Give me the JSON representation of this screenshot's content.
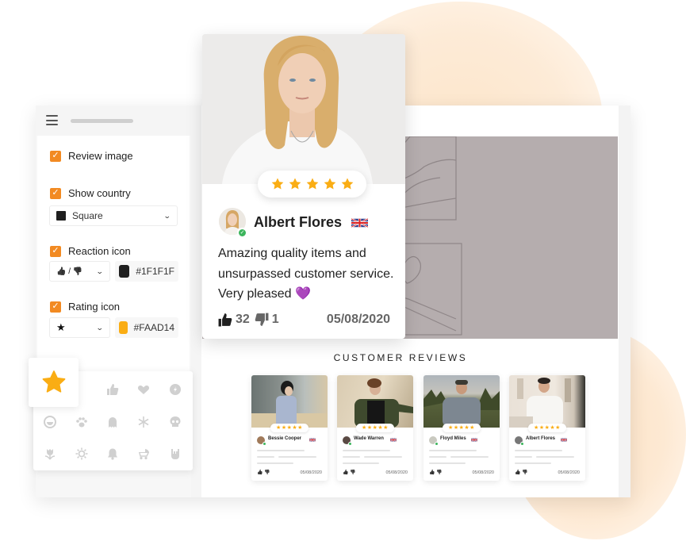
{
  "sidebar": {
    "menu_icon": "hamburger-icon",
    "options": [
      {
        "label": "Review image",
        "checked": true
      },
      {
        "label": "Show country",
        "checked": true,
        "select": {
          "value": "Square",
          "swatch": "#1F1F1F"
        }
      },
      {
        "label": "Reaction icon",
        "checked": true,
        "select": {
          "value": "👍 / 👎"
        },
        "color": {
          "hex": "#1F1F1F",
          "label": "#1F1F1F"
        }
      },
      {
        "label": "Rating icon",
        "checked": true,
        "select": {
          "value": "★"
        },
        "color": {
          "hex": "#FAAD14",
          "label": "#FAAD14"
        }
      }
    ],
    "icon_picker": {
      "selected": "star-icon",
      "icons": [
        "thumbs-up-icon",
        "heart-icon",
        "coin-icon",
        "smile-icon",
        "paw-icon",
        "ghost-icon",
        "snowflake-icon",
        "skull-icon",
        "flower-icon",
        "sun-icon",
        "bell-icon",
        "stroller-icon",
        "rock-hand-icon"
      ]
    }
  },
  "featured_review": {
    "rating": 5,
    "name": "Albert Flores",
    "country": "United Kingdom",
    "verified": true,
    "text": "Amazing quality items and unsurpassed customer service. Very pleased 💜",
    "likes": "32",
    "dislikes": "1",
    "date": "05/08/2020"
  },
  "section": {
    "title": "CUSTOMER REVIEWS"
  },
  "reviews": [
    {
      "name": "Bessie Cooper",
      "rating": 5,
      "date": "05/08/2020",
      "country": "United Kingdom"
    },
    {
      "name": "Wade Warren",
      "rating": 5,
      "date": "05/08/2020",
      "country": "United Kingdom"
    },
    {
      "name": "Floyd Miles",
      "rating": 5,
      "date": "05/08/2020",
      "country": "United Kingdom"
    },
    {
      "name": "Albert Flores",
      "rating": 5,
      "date": "05/08/2020",
      "country": "United Kingdom"
    }
  ],
  "colors": {
    "accent": "#F28A22",
    "star": "#FAAD14",
    "reaction": "#1F1F1F",
    "verified": "#3CB55C",
    "banner": "#B5ADAE"
  },
  "glyphs": {
    "checkmark": "✓",
    "chevron": "⌄",
    "star": "★",
    "stars5": "★★★★★",
    "thumbs_up": "👍",
    "thumbs_down": "👎"
  }
}
